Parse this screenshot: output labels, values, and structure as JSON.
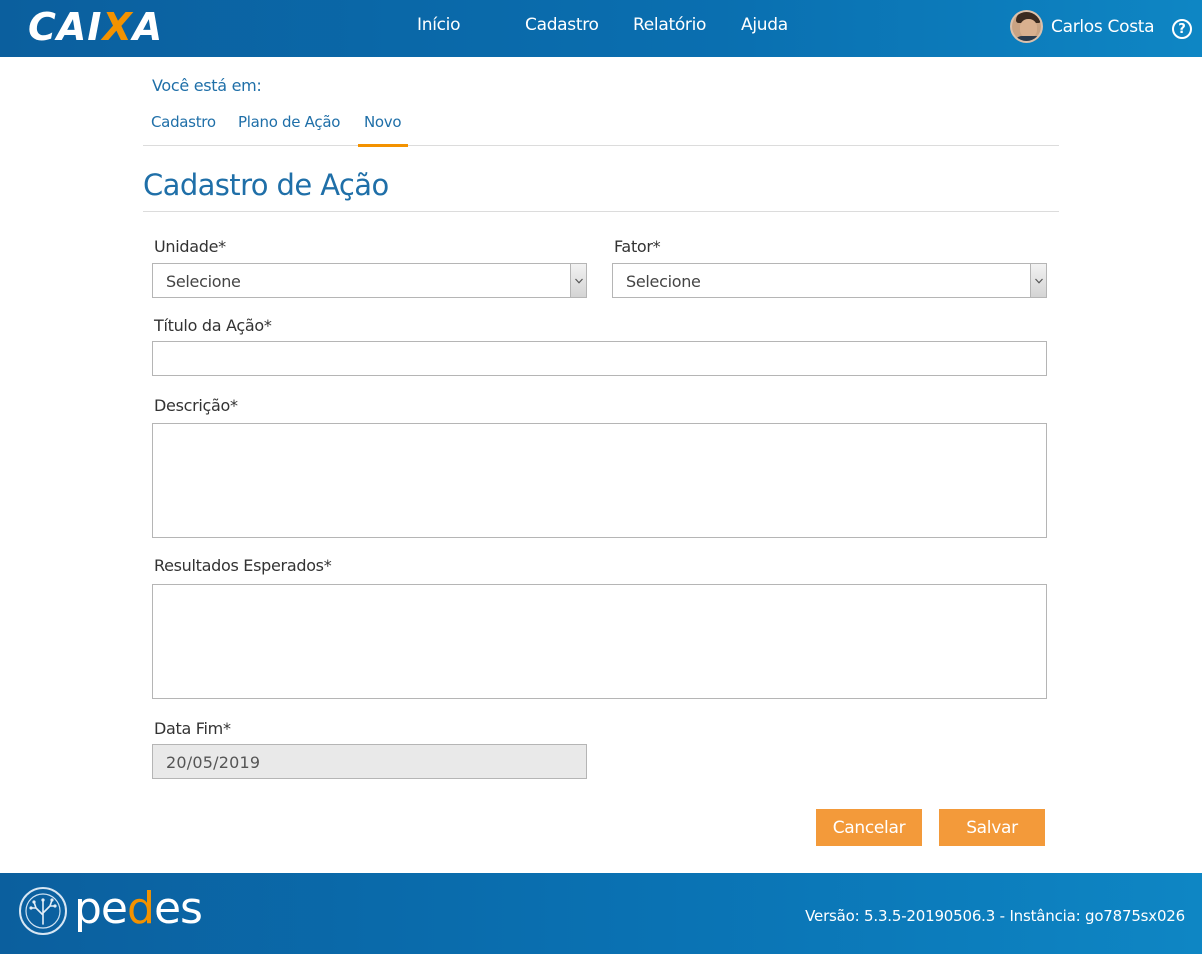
{
  "header": {
    "brand_left": "CAI",
    "brand_x": "X",
    "brand_right": "A",
    "nav": [
      "Início",
      "Cadastro",
      "Relatório",
      "Ajuda"
    ],
    "user_name": "Carlos Costa",
    "help_glyph": "?"
  },
  "breadcrumb": {
    "intro": "Você está em:",
    "items": [
      "Cadastro",
      "Plano de Ação",
      "Novo"
    ],
    "active_index": 2
  },
  "page": {
    "title": "Cadastro de Ação"
  },
  "form": {
    "unidade": {
      "label": "Unidade*",
      "value": "Selecione"
    },
    "fator": {
      "label": "Fator*",
      "value": "Selecione"
    },
    "titulo": {
      "label": "Título da Ação*",
      "value": ""
    },
    "descricao": {
      "label": "Descrição*",
      "value": ""
    },
    "resultados": {
      "label": "Resultados Esperados*",
      "value": ""
    },
    "data_fim": {
      "label": "Data Fim*",
      "value": "20/05/2019"
    }
  },
  "buttons": {
    "cancel": "Cancelar",
    "save": "Salvar"
  },
  "footer": {
    "brand_pe": "pe",
    "brand_d": "d",
    "brand_es": "es",
    "version": "Versão: 5.3.5-20190506.3 - Instância: go7875sx026"
  },
  "colors": {
    "primary": "#0b5f9e",
    "accent": "#f39200",
    "button": "#f39a3a",
    "link": "#1f6fa8"
  }
}
